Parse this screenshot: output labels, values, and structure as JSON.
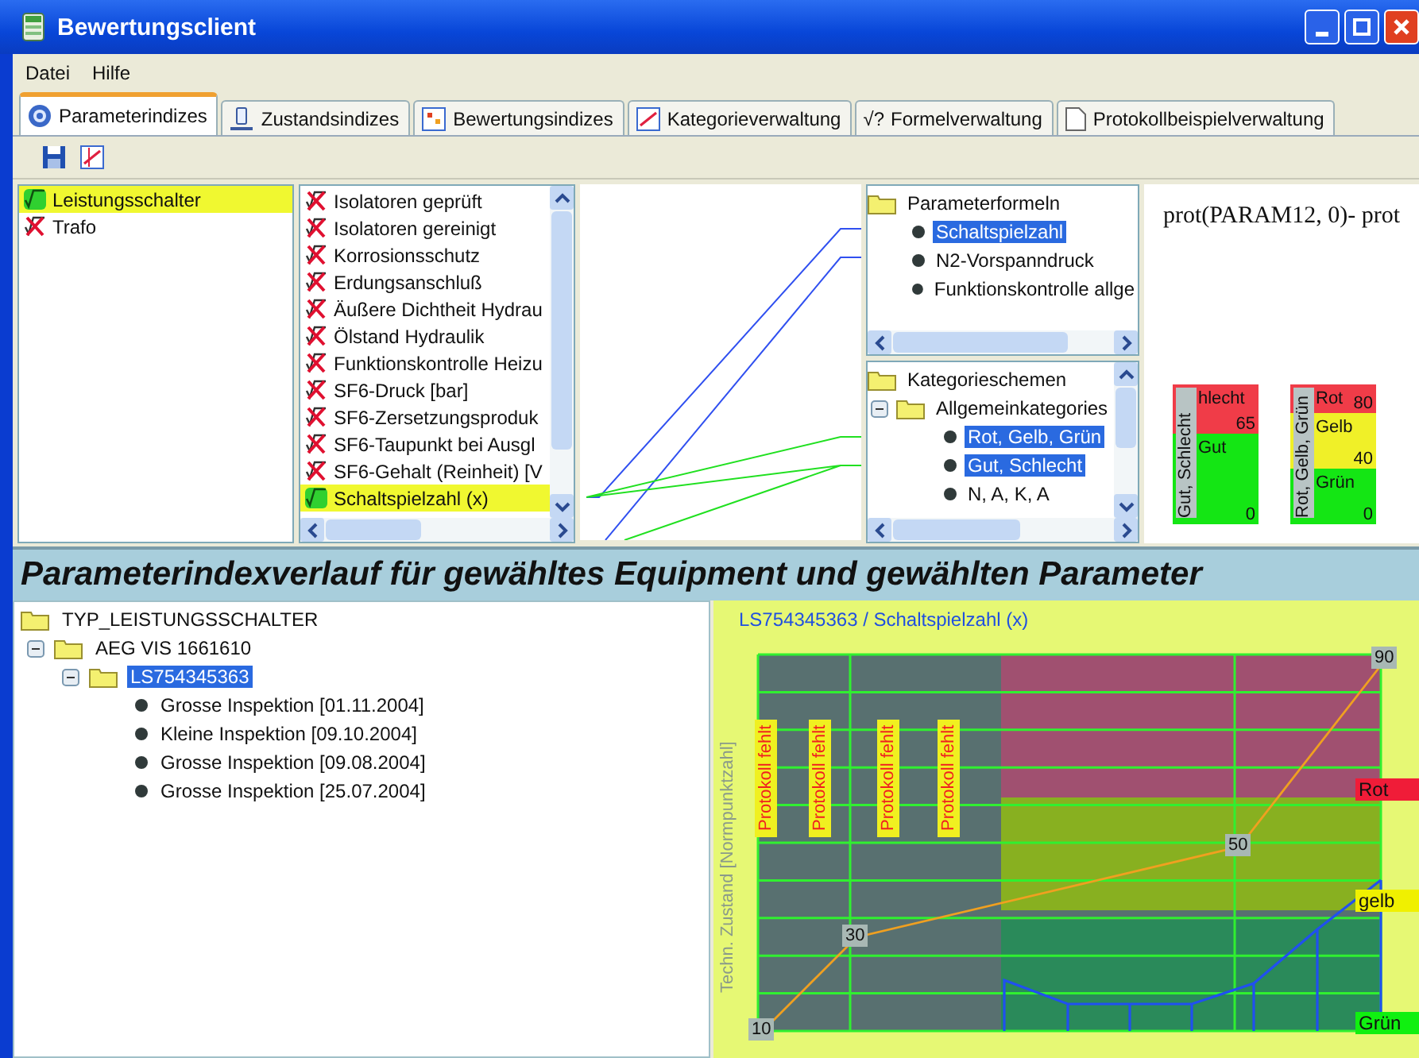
{
  "window": {
    "title": "Bewertungsclient"
  },
  "menu": [
    "Datei",
    "Hilfe"
  ],
  "tabs": [
    {
      "label": "Parameterindizes",
      "selected": true,
      "kind": "gear"
    },
    {
      "label": "Zustandsindizes",
      "selected": false,
      "kind": "device"
    },
    {
      "label": "Bewertungsindizes",
      "selected": false,
      "kind": "grid"
    },
    {
      "label": "Kategorieverwaltung",
      "selected": false,
      "kind": "chart"
    },
    {
      "label": "Formelverwaltung",
      "selected": false,
      "kind": "formula",
      "symbol": "√?"
    },
    {
      "label": "Protokollbeispielverwaltung",
      "selected": false,
      "kind": "document"
    }
  ],
  "equipment": [
    {
      "label": "Leistungsschalter",
      "selected": true,
      "kind": "valid"
    },
    {
      "label": "Trafo",
      "selected": false,
      "kind": "invalid"
    }
  ],
  "parameters": [
    {
      "label": "Isolatoren geprüft",
      "selected": false,
      "kind": "invalid"
    },
    {
      "label": "Isolatoren gereinigt",
      "selected": false,
      "kind": "invalid"
    },
    {
      "label": "Korrosionsschutz",
      "selected": false,
      "kind": "invalid"
    },
    {
      "label": "Erdungsanschluß",
      "selected": false,
      "kind": "invalid"
    },
    {
      "label": "Äußere Dichtheit Hydrau",
      "selected": false,
      "kind": "invalid"
    },
    {
      "label": "Ölstand Hydraulik",
      "selected": false,
      "kind": "invalid"
    },
    {
      "label": "Funktionskontrolle Heizu",
      "selected": false,
      "kind": "invalid"
    },
    {
      "label": "SF6-Druck [bar]",
      "selected": false,
      "kind": "invalid"
    },
    {
      "label": "SF6-Zersetzungsproduk",
      "selected": false,
      "kind": "invalid"
    },
    {
      "label": "SF6-Taupunkt bei Ausgl",
      "selected": false,
      "kind": "invalid"
    },
    {
      "label": "SF6-Gehalt (Reinheit) [V",
      "selected": false,
      "kind": "invalid"
    },
    {
      "label": "Schaltspielzahl (x)",
      "selected": true,
      "kind": "valid"
    }
  ],
  "formula_tree": [
    {
      "label": "Parameterformeln",
      "kind": "folder",
      "selected": false,
      "children": [
        {
          "label": "Schaltspielzahl",
          "kind": "item",
          "selected": true
        },
        {
          "label": "N2-Vorspanndruck",
          "kind": "item",
          "selected": false
        },
        {
          "label": "Funktionskontrolle allge",
          "kind": "item",
          "selected": false
        }
      ]
    }
  ],
  "category_tree": [
    {
      "label": "Kategorieschemen",
      "kind": "folder",
      "selected": false,
      "children": [
        {
          "label": "Allgemeinkategories",
          "kind": "folder",
          "selected": false,
          "expanded": true,
          "children": [
            {
              "label": "Rot, Gelb, Grün",
              "kind": "item",
              "selected": true
            },
            {
              "label": "Gut, Schlecht",
              "kind": "item",
              "selected": true
            },
            {
              "label": "N, A, K, A",
              "kind": "item",
              "selected": false
            }
          ]
        }
      ]
    }
  ],
  "formula_text": "prot(PARAM12, 0)- prot",
  "category_charts": [
    {
      "label": "Gut, Schlecht",
      "segments": [
        {
          "name": "hlecht",
          "value": "65",
          "color": "#f03c48"
        },
        {
          "name": "Gut",
          "value": "0",
          "color": "#14e614"
        }
      ]
    },
    {
      "label": "Rot, Gelb, Grün",
      "segments": [
        {
          "name": "Rot",
          "value": "80",
          "color": "#f03c48"
        },
        {
          "name": "Gelb",
          "value": "40",
          "color": "#f0f028"
        },
        {
          "name": "Grün",
          "value": "0",
          "color": "#14e614"
        }
      ]
    }
  ],
  "heading": "Parameterindexverlauf für gewähltes Equipment und gewählten Parameter",
  "equipment_tree": [
    {
      "label": "TYP_LEISTUNGSSCHALTER",
      "kind": "folder",
      "selected": false,
      "children": [
        {
          "label": "AEG VIS 1661610",
          "kind": "folder",
          "selected": false,
          "expanded": true,
          "children": [
            {
              "label": "LS754345363",
              "kind": "folder",
              "selected": true,
              "expanded": true,
              "children": [
                {
                  "label": "Grosse Inspektion [01.11.2004]",
                  "kind": "item",
                  "selected": false
                },
                {
                  "label": "Kleine Inspektion [09.10.2004]",
                  "kind": "item",
                  "selected": false
                },
                {
                  "label": "Grosse Inspektion [09.08.2004]",
                  "kind": "item",
                  "selected": false
                },
                {
                  "label": "Grosse Inspektion [25.07.2004]",
                  "kind": "item",
                  "selected": false
                }
              ]
            }
          ]
        }
      ]
    }
  ],
  "history_chart": {
    "title": "LS754345363 / Schaltspielzahl (x)",
    "ylabel": "Techn. Zustand [Normpunktzahl]",
    "missing_tags": [
      "Protokoll fehlt",
      "Protokoll fehlt",
      "Protokoll fehlt",
      "Protokoll fehlt"
    ],
    "points": [
      "10",
      "30",
      "50",
      "90"
    ],
    "bands": [
      {
        "label": "Rot",
        "color": "#f01c38"
      },
      {
        "label": "gelb",
        "color": "#f0f000"
      },
      {
        "label": "Grün",
        "color": "#10f010"
      }
    ]
  }
}
